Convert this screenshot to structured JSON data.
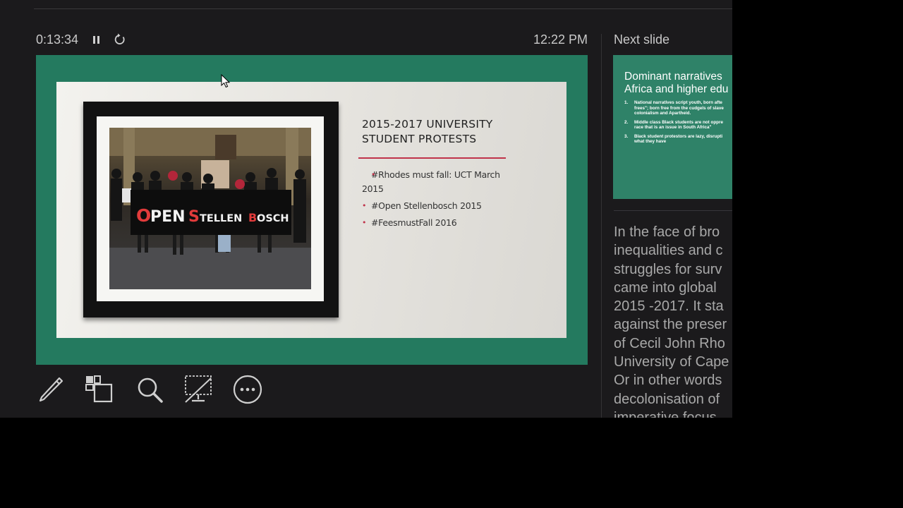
{
  "header": {
    "timer": "0:13:34",
    "clock": "12:22 PM",
    "next_label": "Next slide"
  },
  "controls": {
    "pause_icon": "pause-icon",
    "restart_icon": "restart-icon"
  },
  "current_slide": {
    "title": "2015-2017 UNIVERSITY\nSTUDENT PROTESTS",
    "bullets": [
      "#Rhodes must fall: UCT March 2015",
      "#Open Stellenbosch 2015",
      "#FeesmustFall 2016"
    ],
    "banner_text": "OPEN STELLENBOSCH",
    "colors": {
      "background": "#247a5f",
      "accent": "#c0334a"
    }
  },
  "toolbar": {
    "tools": [
      "pen-icon",
      "slides-grid-icon",
      "zoom-icon",
      "black-screen-icon",
      "more-options-icon"
    ]
  },
  "next_slide": {
    "title": "Dominant narratives\nAfrica and higher edu",
    "items": [
      {
        "num": "1.",
        "text": "National narratives script youth, born afte\nfrees\"; born free from the cudgels of slave\ncolonialism and Apartheid."
      },
      {
        "num": "2.",
        "text": "Middle class Black students are not oppre\nrace that is an issue in South Africa\""
      },
      {
        "num": "3.",
        "text": "Black student protestors are lazy, disrupti\nwhat they have"
      }
    ]
  },
  "notes": {
    "text": "In the face of bro\ninequalities and c\nstruggles for surv\ncame into global\n2015 -2017. It sta\nagainst the preser\nof Cecil John Rho\nUniversity of Cape\nOr in other words\ndecolonisation of\nimperative focus"
  }
}
